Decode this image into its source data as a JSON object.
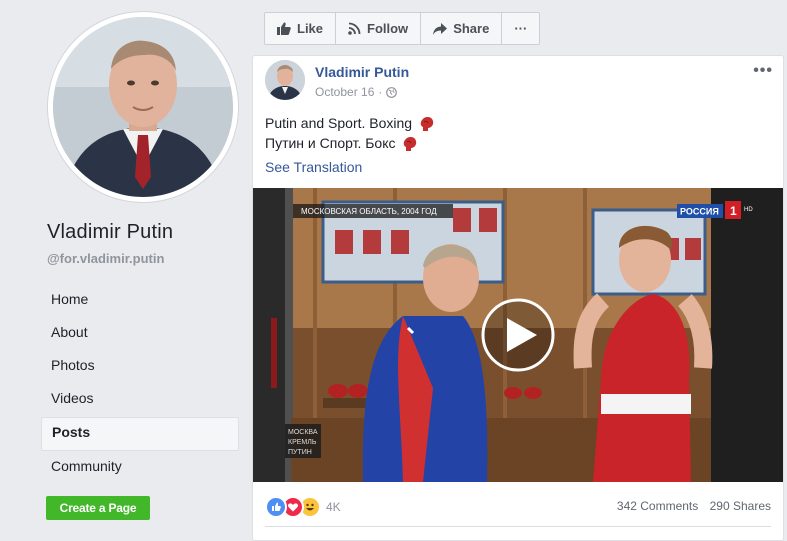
{
  "sidebar": {
    "page_name": "Vladimir Putin",
    "handle": "@for.vladimir.putin",
    "nav_items": [
      {
        "label": "Home",
        "active": false
      },
      {
        "label": "About",
        "active": false
      },
      {
        "label": "Photos",
        "active": false
      },
      {
        "label": "Videos",
        "active": false
      },
      {
        "label": "Posts",
        "active": true
      },
      {
        "label": "Community",
        "active": false
      }
    ],
    "create_page_label": "Create a Page"
  },
  "action_bar": {
    "like_label": "Like",
    "follow_label": "Follow",
    "share_label": "Share",
    "more_label": "···"
  },
  "post": {
    "author": "Vladimir Putin",
    "date": "October 16",
    "more_label": "•••",
    "text_line1": "Putin and Sport. Boxing",
    "text_line2": "Путин и Спорт. Бокс",
    "see_translation": "See Translation",
    "video": {
      "caption_top": "МОСКОВСКАЯ ОБЛАСТЬ, 2004 ГОД",
      "channel_logo": "РОССИЯ",
      "channel_number": "1",
      "channel_suffix": "HD",
      "bottom_left_line1": "МОСКВА",
      "bottom_left_line2": "КРЕМЛЬ",
      "bottom_left_line3": "ПУТИН"
    },
    "reactions_count": "4K",
    "comments": "342 Comments",
    "shares": "290 Shares"
  },
  "colors": {
    "link_blue": "#365899",
    "create_green": "#42b72a",
    "background": "#e9ebee"
  }
}
